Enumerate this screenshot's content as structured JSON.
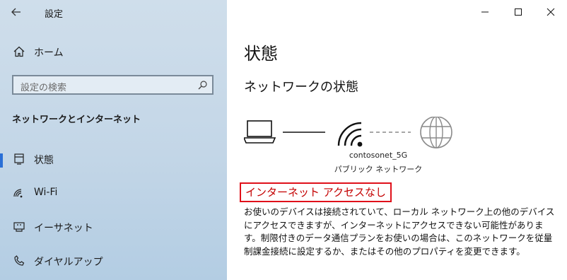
{
  "app": {
    "title": "設定"
  },
  "sidebar": {
    "home_label": "ホーム",
    "search_placeholder": "設定の検索",
    "section_title": "ネットワークとインターネット",
    "items": [
      {
        "label": "状態",
        "icon": "status-icon",
        "selected": true
      },
      {
        "label": "Wi-Fi",
        "icon": "wifi-icon",
        "selected": false
      },
      {
        "label": "イーサネット",
        "icon": "ethernet-icon",
        "selected": false
      },
      {
        "label": "ダイヤルアップ",
        "icon": "dialup-icon",
        "selected": false
      }
    ]
  },
  "main": {
    "title": "状態",
    "subtitle": "ネットワークの状態",
    "network_name": "contosonet_5G",
    "network_type": "パブリック ネットワーク",
    "status": "インターネット アクセスなし",
    "description": "お使いのデバイスは接続されていて、ローカル ネットワーク上の他のデバイスにアクセスできますが、インターネットにアクセスできない可能性があります。制限付きのデータ通信プランをお使いの場合は、このネットワークを従量制課金接続に設定するか、またはその他のプロパティを変更できます。"
  },
  "colors": {
    "accent": "#2a6fd6",
    "error": "#e0101a",
    "error_text": "#c40000"
  }
}
